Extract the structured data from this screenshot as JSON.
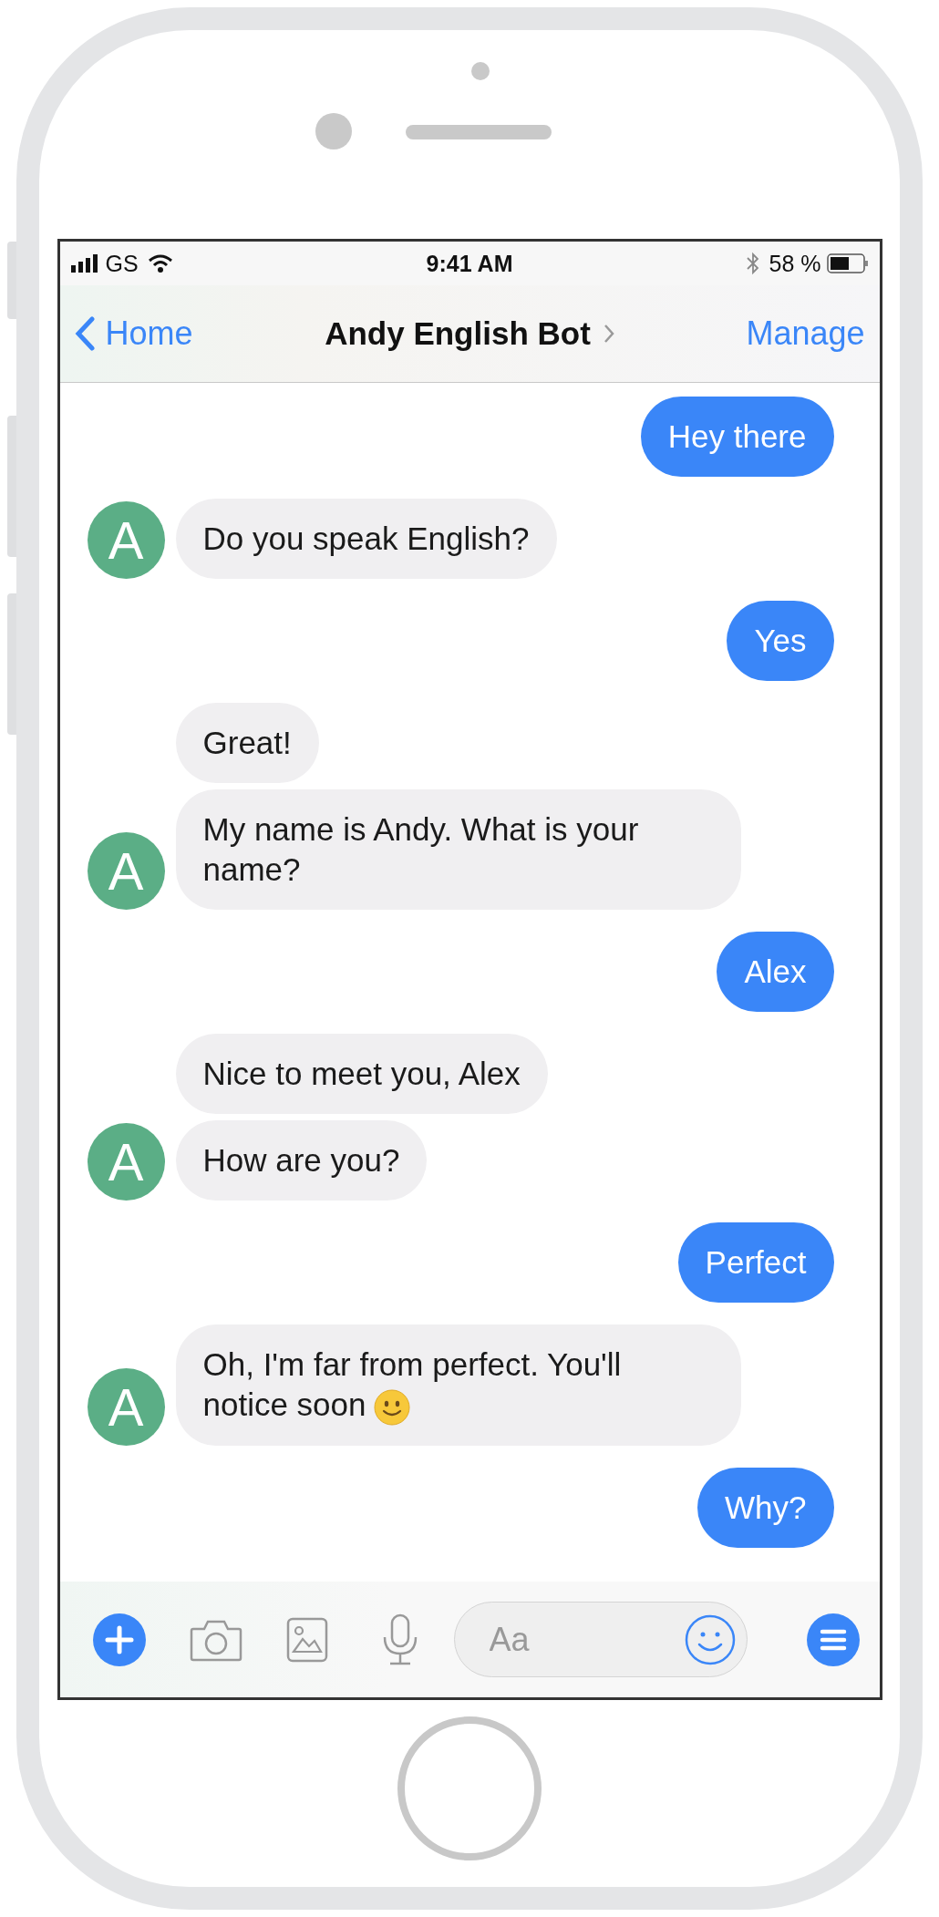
{
  "status_bar": {
    "carrier": "GS",
    "time": "9:41 AM",
    "battery": "58 %"
  },
  "nav": {
    "back": "Home",
    "title": "Andy English Bot",
    "action": "Manage"
  },
  "messages": [
    {
      "kind": "sent",
      "bubbles": [
        {
          "kind": "plain",
          "text": "Hey there"
        }
      ]
    },
    {
      "kind": "received",
      "avatar": "A",
      "bubbles": [
        {
          "kind": "plain",
          "text": "Do you speak English?"
        }
      ]
    },
    {
      "kind": "sent",
      "bubbles": [
        {
          "kind": "plain",
          "text": "Yes"
        }
      ]
    },
    {
      "kind": "received",
      "avatar": "A",
      "bubbles": [
        {
          "kind": "plain",
          "text": "Great!"
        },
        {
          "kind": "plain",
          "text": "My name is Andy. What is your name?"
        }
      ]
    },
    {
      "kind": "sent",
      "bubbles": [
        {
          "kind": "plain",
          "text": "Alex"
        }
      ]
    },
    {
      "kind": "received",
      "avatar": "A",
      "bubbles": [
        {
          "kind": "plain",
          "text": "Nice to meet you, Alex"
        },
        {
          "kind": "plain",
          "text": "How are you?"
        }
      ]
    },
    {
      "kind": "sent",
      "bubbles": [
        {
          "kind": "plain",
          "text": "Perfect"
        }
      ]
    },
    {
      "kind": "received",
      "avatar": "A",
      "bubbles": [
        {
          "kind": "emoji",
          "text": "Oh, I'm far from perfect. You'll notice soon"
        }
      ]
    },
    {
      "kind": "sent",
      "bubbles": [
        {
          "kind": "plain",
          "text": "Why?"
        }
      ]
    }
  ],
  "composer": {
    "placeholder": "Aa"
  }
}
